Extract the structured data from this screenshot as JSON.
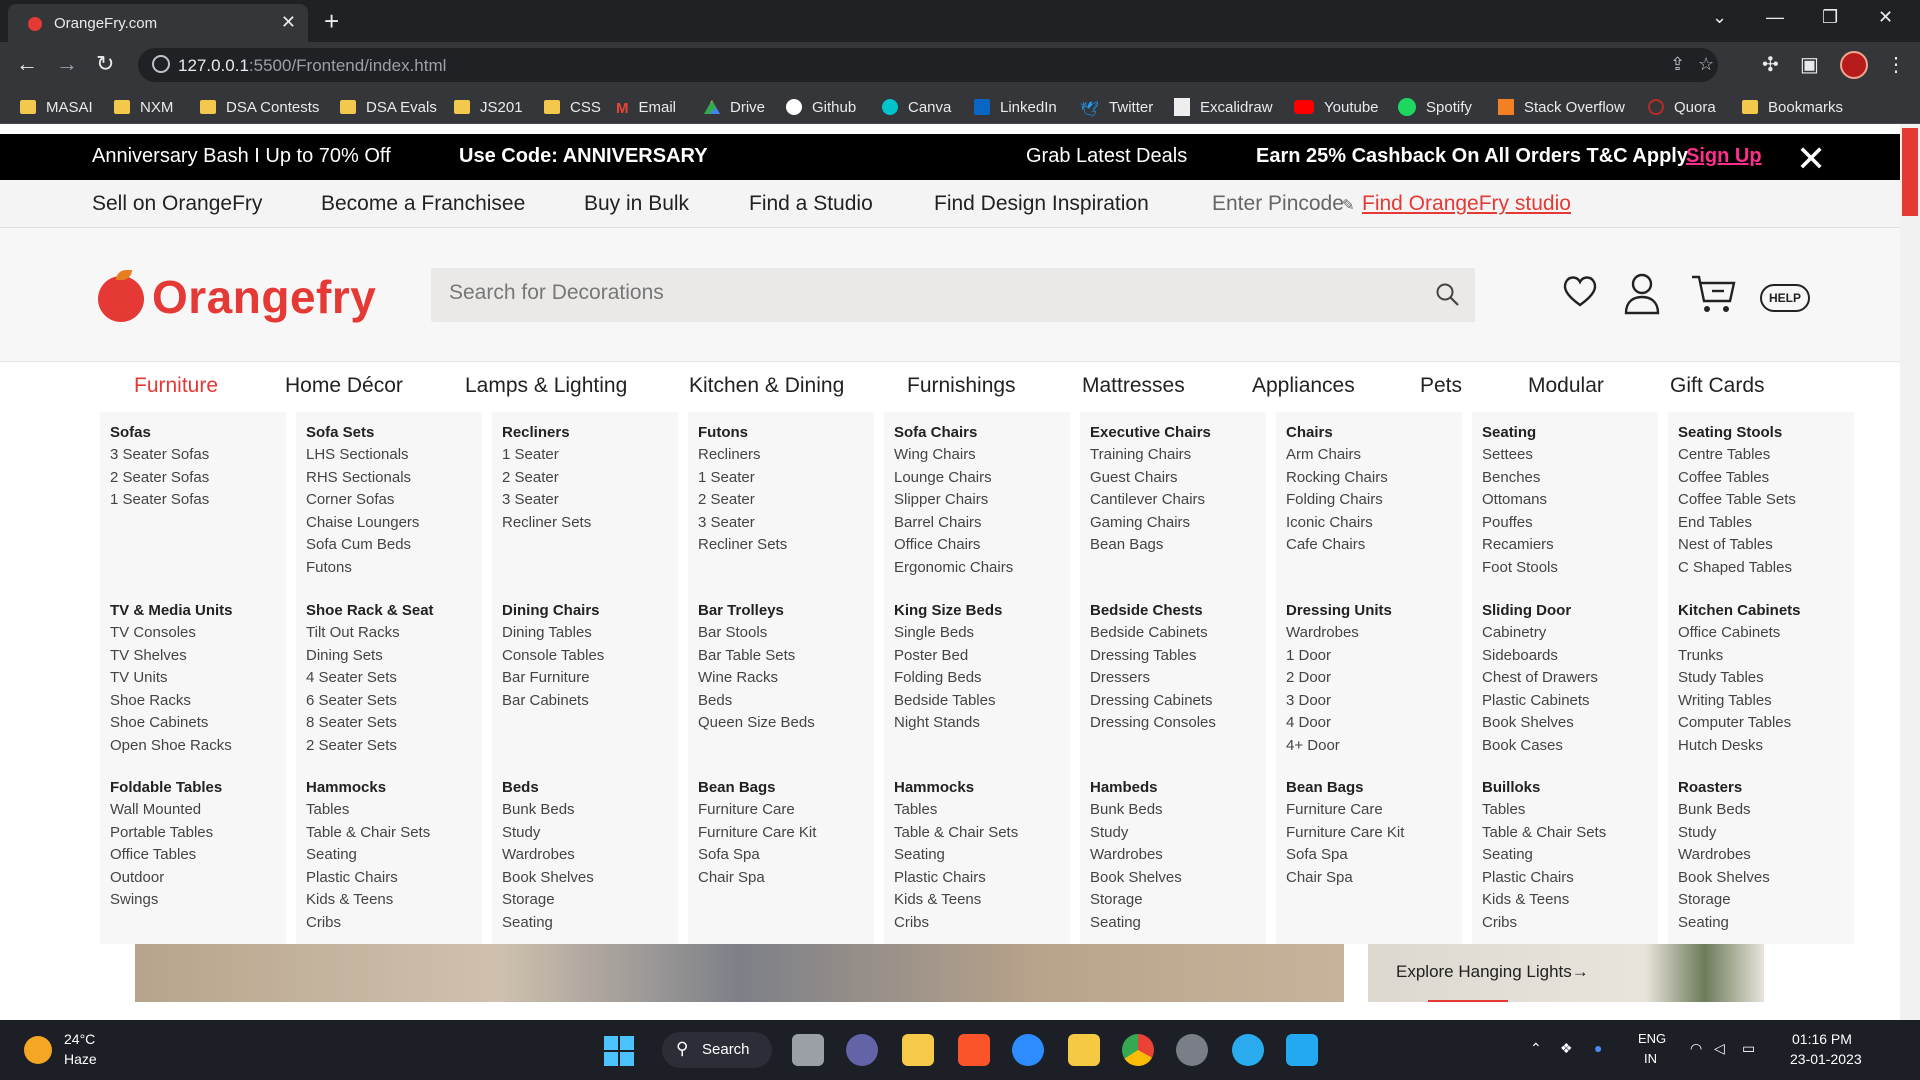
{
  "browser": {
    "tab_title": "OrangeFry.com",
    "url_host": "127.0.0.1",
    "url_path": ":5500/Frontend/index.html",
    "bookmarks": [
      "MASAI",
      "NXM",
      "DSA Contests",
      "DSA Evals",
      "JS201",
      "CSS",
      "Email",
      "Drive",
      "Github",
      "Canva",
      "LinkedIn",
      "Twitter",
      "Excalidraw",
      "Youtube",
      "Spotify",
      "Stack Overflow",
      "Quora",
      "Bookmarks"
    ]
  },
  "promo": {
    "text1": "Anniversary Bash I Up to 70% Off",
    "text2": "Use Code: ANNIVERSARY",
    "text3": "Grab Latest Deals",
    "text4": "Earn 25% Cashback On All Orders T&C Apply",
    "signup": "Sign Up",
    "close": "✕"
  },
  "util": {
    "links": [
      "Sell on OrangeFry",
      "Become a Franchisee",
      "Buy in Bulk",
      "Find a Studio",
      "Find Design Inspiration"
    ],
    "pincode": "Enter Pincode",
    "studio_link": "Find OrangeFry studio"
  },
  "header": {
    "logo": "Orangefry",
    "search_placeholder": "Search for Decorations",
    "help": "HELP"
  },
  "categories": [
    "Furniture",
    "Home Décor",
    "Lamps & Lighting",
    "Kitchen & Dining",
    "Furnishings",
    "Mattresses",
    "Appliances",
    "Pets",
    "Modular",
    "Gift Cards"
  ],
  "menu": [
    [
      {
        "title": "Sofas",
        "items": [
          "3 Seater Sofas",
          "2 Seater Sofas",
          "1 Seater Sofas"
        ]
      },
      {
        "title": "TV & Media Units",
        "items": [
          "TV Consoles",
          "TV Shelves",
          "TV Units",
          "Shoe Racks",
          "Shoe Cabinets",
          "Open Shoe Racks"
        ]
      },
      {
        "title": "Foldable Tables",
        "items": [
          "Wall Mounted",
          "Portable Tables",
          "Office Tables",
          "Outdoor",
          "Swings"
        ]
      }
    ],
    [
      {
        "title": "Sofa Sets",
        "items": [
          "LHS Sectionals",
          "RHS Sectionals",
          "Corner Sofas",
          "Chaise Loungers",
          "Sofa Cum Beds",
          "Futons"
        ]
      },
      {
        "title": "Shoe Rack & Seat",
        "items": [
          "Tilt Out Racks",
          "Dining Sets",
          "4 Seater Sets",
          "6 Seater Sets",
          "8 Seater Sets",
          "2 Seater Sets"
        ]
      },
      {
        "title": "Hammocks",
        "items": [
          "Tables",
          "Table & Chair Sets",
          "Seating",
          "Plastic Chairs",
          "Kids & Teens",
          "Cribs"
        ]
      }
    ],
    [
      {
        "title": "Recliners",
        "items": [
          "1 Seater",
          "2 Seater",
          "3 Seater",
          "Recliner Sets"
        ]
      },
      {
        "title": "Dining Chairs",
        "items": [
          "Dining Tables",
          "Console Tables",
          "Bar Furniture",
          "Bar Cabinets"
        ]
      },
      {
        "title": "Beds",
        "items": [
          "Bunk Beds",
          "Study",
          "Wardrobes",
          "Book Shelves",
          "Storage",
          "Seating"
        ]
      }
    ],
    [
      {
        "title": "Futons",
        "items": [
          "Recliners",
          "1 Seater",
          "2 Seater",
          "3 Seater",
          "Recliner Sets"
        ]
      },
      {
        "title": "Bar Trolleys",
        "items": [
          "Bar Stools",
          "Bar Table Sets",
          "Wine Racks",
          "Beds",
          "Queen Size Beds"
        ]
      },
      {
        "title": "Bean Bags",
        "items": [
          "Furniture Care",
          "Furniture Care Kit",
          "Sofa Spa",
          "Chair Spa"
        ]
      }
    ],
    [
      {
        "title": "Sofa Chairs",
        "items": [
          "Wing Chairs",
          "Lounge Chairs",
          "Slipper Chairs",
          "Barrel Chairs",
          "Office Chairs",
          "Ergonomic Chairs"
        ]
      },
      {
        "title": "King Size Beds",
        "items": [
          "Single Beds",
          "Poster Bed",
          "Folding Beds",
          "Bedside Tables",
          "Night Stands"
        ]
      },
      {
        "title": "Hammocks",
        "items": [
          "Tables",
          "Table & Chair Sets",
          "Seating",
          "Plastic Chairs",
          "Kids & Teens",
          "Cribs"
        ]
      }
    ],
    [
      {
        "title": "Executive Chairs",
        "items": [
          "Training Chairs",
          "Guest Chairs",
          "Cantilever Chairs",
          "Gaming Chairs",
          "Bean Bags"
        ]
      },
      {
        "title": "Bedside Chests",
        "items": [
          "Bedside Cabinets",
          "Dressing Tables",
          "Dressers",
          "Dressing Cabinets",
          "Dressing Consoles"
        ]
      },
      {
        "title": "Hambeds",
        "items": [
          "Bunk Beds",
          "Study",
          "Wardrobes",
          "Book Shelves",
          "Storage",
          "Seating"
        ]
      }
    ],
    [
      {
        "title": "Chairs",
        "items": [
          "Arm Chairs",
          "Rocking Chairs",
          "Folding Chairs",
          "Iconic Chairs",
          "Cafe Chairs"
        ]
      },
      {
        "title": "Dressing Units",
        "items": [
          "Wardrobes",
          "1 Door",
          "2 Door",
          "3 Door",
          "4 Door",
          "4+ Door"
        ]
      },
      {
        "title": "Bean Bags",
        "items": [
          "Furniture Care",
          "Furniture Care Kit",
          "Sofa Spa",
          "Chair Spa"
        ]
      }
    ],
    [
      {
        "title": "Seating",
        "items": [
          "Settees",
          "Benches",
          "Ottomans",
          "Pouffes",
          "Recamiers",
          "Foot Stools"
        ]
      },
      {
        "title": "Sliding Door",
        "items": [
          "Cabinetry",
          "Sideboards",
          "Chest of Drawers",
          "Plastic Cabinets",
          "Book Shelves",
          "Book Cases"
        ]
      },
      {
        "title": "Builloks",
        "items": [
          "Tables",
          "Table & Chair Sets",
          "Seating",
          "Plastic Chairs",
          "Kids & Teens",
          "Cribs"
        ]
      }
    ],
    [
      {
        "title": "Seating Stools",
        "items": [
          "Centre Tables",
          "Coffee Tables",
          "Coffee Table Sets",
          "End Tables",
          "Nest of Tables",
          "C Shaped Tables"
        ]
      },
      {
        "title": "Kitchen Cabinets",
        "items": [
          "Office Cabinets",
          "Trunks",
          "Study Tables",
          "Writing Tables",
          "Computer Tables",
          "Hutch Desks"
        ]
      },
      {
        "title": "Roasters",
        "items": [
          "Bunk Beds",
          "Study",
          "Wardrobes",
          "Book Shelves",
          "Storage",
          "Seating"
        ]
      }
    ]
  ],
  "banner": {
    "explore": "Explore Hanging Lights→"
  },
  "taskbar": {
    "temp": "24°C",
    "weather": "Haze",
    "search": "Search",
    "lang1": "ENG",
    "lang2": "IN",
    "time": "01:16 PM",
    "date": "23-01-2023"
  },
  "colors": {
    "brand": "#e53935",
    "signup": "#ff2e8e"
  }
}
